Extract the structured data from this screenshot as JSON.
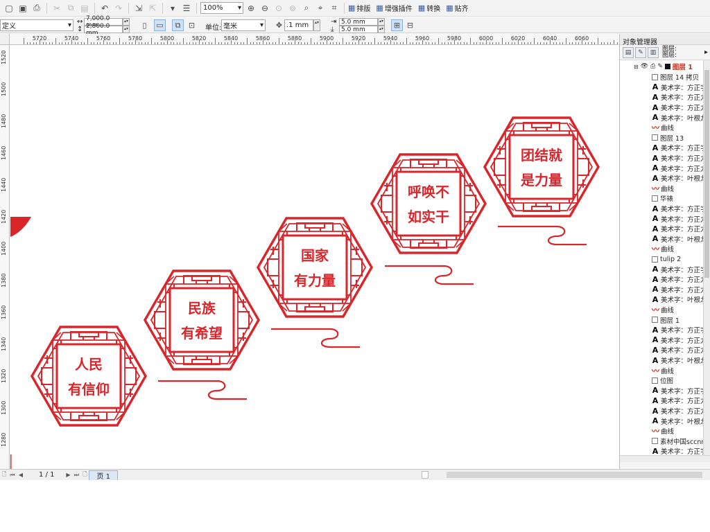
{
  "toolbar": {
    "zoom": "100%",
    "buttons": [
      {
        "label": "排版",
        "icon": "layout-icon"
      },
      {
        "label": "增强插件",
        "icon": "plugin-icon"
      },
      {
        "label": "转换",
        "icon": "convert-icon"
      },
      {
        "label": "贴齐",
        "icon": "snap-icon"
      }
    ]
  },
  "property_bar": {
    "page_preset": "定义",
    "width": "7,000.0 mm",
    "height": "2,800.0 mm",
    "units_label": "单位:",
    "units_value": "毫米",
    "nudge": ".1 mm",
    "dup_x": "5.0 mm",
    "dup_y": "5.0 mm"
  },
  "rulers": {
    "h_labels": [
      "5720",
      "5740",
      "5760",
      "5780",
      "5800",
      "5820",
      "5840",
      "5860",
      "5880",
      "5900",
      "5920",
      "5940",
      "5960",
      "5980",
      "6000",
      "6020",
      "6040",
      "6060"
    ],
    "v_labels": [
      "1520",
      "1500",
      "1480",
      "1460",
      "1440",
      "1420",
      "1400",
      "1380",
      "1360",
      "1340",
      "1320",
      "1300",
      "1280"
    ]
  },
  "artwork": {
    "color": "#d8262b",
    "panels": [
      {
        "line1": "人民",
        "line2": "有信仰"
      },
      {
        "line1": "民族",
        "line2": "有希望"
      },
      {
        "line1": "国家",
        "line2": "有力量"
      },
      {
        "line1": "呼唤不",
        "line2": "如实干"
      },
      {
        "line1": "团结就",
        "line2": "是力量"
      }
    ]
  },
  "docker": {
    "title": "对象管理器",
    "layers_label": "图层:",
    "layer_top": "图层 1",
    "tree": [
      {
        "icon": "group",
        "text": "图层 14 拷贝",
        "indent": 1
      },
      {
        "icon": "text",
        "text": "美术字：方正字",
        "indent": 1
      },
      {
        "icon": "text",
        "text": "美术字：方正力",
        "indent": 1
      },
      {
        "icon": "text",
        "text": "美术字：方正力",
        "indent": 1
      },
      {
        "icon": "text",
        "text": "美术字：叶根龙",
        "indent": 1
      },
      {
        "icon": "curve",
        "text": "曲线",
        "indent": 1
      },
      {
        "icon": "group",
        "text": "图层 13",
        "indent": 1
      },
      {
        "icon": "text",
        "text": "美术字：方正字",
        "indent": 1
      },
      {
        "icon": "text",
        "text": "美术字：方正力",
        "indent": 1
      },
      {
        "icon": "text",
        "text": "美术字：方正力",
        "indent": 1
      },
      {
        "icon": "text",
        "text": "美术字：叶根龙",
        "indent": 1
      },
      {
        "icon": "curve",
        "text": "曲线",
        "indent": 1
      },
      {
        "icon": "group",
        "text": "华裱",
        "indent": 1
      },
      {
        "icon": "text",
        "text": "美术字：方正字",
        "indent": 1
      },
      {
        "icon": "text",
        "text": "美术字：方正力",
        "indent": 1
      },
      {
        "icon": "text",
        "text": "美术字：方正力",
        "indent": 1
      },
      {
        "icon": "text",
        "text": "美术字：叶根龙",
        "indent": 1
      },
      {
        "icon": "curve",
        "text": "曲线",
        "indent": 1
      },
      {
        "icon": "group",
        "text": "tulip 2",
        "indent": 1
      },
      {
        "icon": "text",
        "text": "美术字：方正字",
        "indent": 1
      },
      {
        "icon": "text",
        "text": "美术字：方正力",
        "indent": 1
      },
      {
        "icon": "text",
        "text": "美术字：方正力",
        "indent": 1
      },
      {
        "icon": "text",
        "text": "美术字：叶根龙",
        "indent": 1
      },
      {
        "icon": "curve",
        "text": "曲线",
        "indent": 1
      },
      {
        "icon": "group",
        "text": "图层 1",
        "indent": 1
      },
      {
        "icon": "text",
        "text": "美术字：方正字",
        "indent": 1
      },
      {
        "icon": "text",
        "text": "美术字：方正力",
        "indent": 1
      },
      {
        "icon": "text",
        "text": "美术字：方正力",
        "indent": 1
      },
      {
        "icon": "text",
        "text": "美术字：叶根龙",
        "indent": 1
      },
      {
        "icon": "curve",
        "text": "曲线",
        "indent": 1
      },
      {
        "icon": "group",
        "text": "位图",
        "indent": 1
      },
      {
        "icon": "text",
        "text": "美术字：方正字",
        "indent": 1
      },
      {
        "icon": "text",
        "text": "美术字：方正力",
        "indent": 1
      },
      {
        "icon": "text",
        "text": "美术字：方正力",
        "indent": 1
      },
      {
        "icon": "text",
        "text": "美术字：叶根龙",
        "indent": 1
      },
      {
        "icon": "curve",
        "text": "曲线",
        "indent": 1
      },
      {
        "icon": "group",
        "text": "素材中国sccnn",
        "indent": 1
      },
      {
        "icon": "text",
        "text": "美术字：方正字",
        "indent": 1
      }
    ]
  },
  "status": {
    "page_count": "1 / 1",
    "page_tab": "页 1"
  }
}
